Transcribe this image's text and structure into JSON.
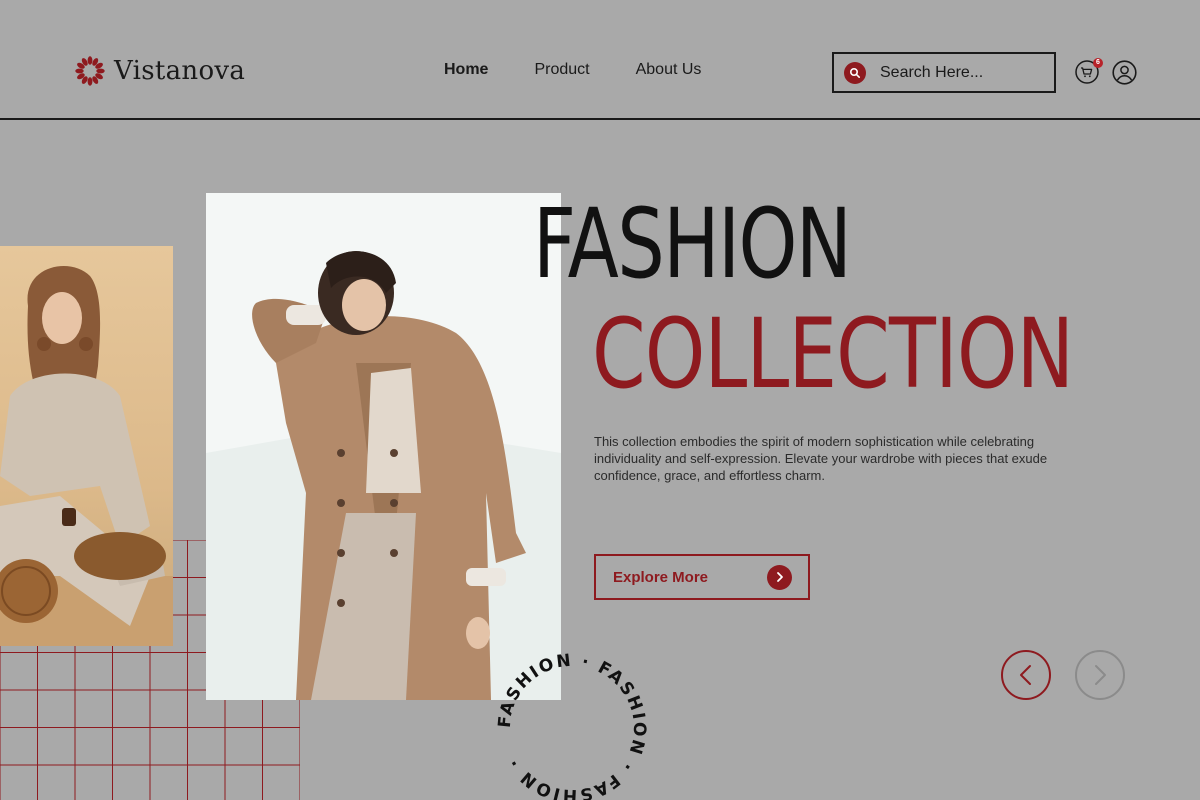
{
  "brand": {
    "name": "Vistanova",
    "accent_color": "#8e1a1f"
  },
  "nav": {
    "items": [
      {
        "label": "Home",
        "active": true
      },
      {
        "label": "Product",
        "active": false
      },
      {
        "label": "About Us",
        "active": false
      }
    ]
  },
  "search": {
    "placeholder": "Search Here..."
  },
  "cart": {
    "count": "6"
  },
  "hero": {
    "title_line1": "FASHION",
    "title_line2": "COLLECTION",
    "description": "This collection embodies the spirit of modern sophistication while celebrating individuality and self-expression. Elevate your wardrobe with pieces that exude confidence, grace, and effortless charm.",
    "cta_label": "Explore More"
  },
  "circle_badge": {
    "text": "FASHION · FASHION · FASHION · "
  },
  "icons": {
    "logo": "flower-logo-icon",
    "search": "search-icon",
    "cart": "cart-icon",
    "profile": "user-icon",
    "cta_arrow": "chevron-right-icon",
    "prev": "chevron-left-icon",
    "next": "chevron-right-icon"
  }
}
